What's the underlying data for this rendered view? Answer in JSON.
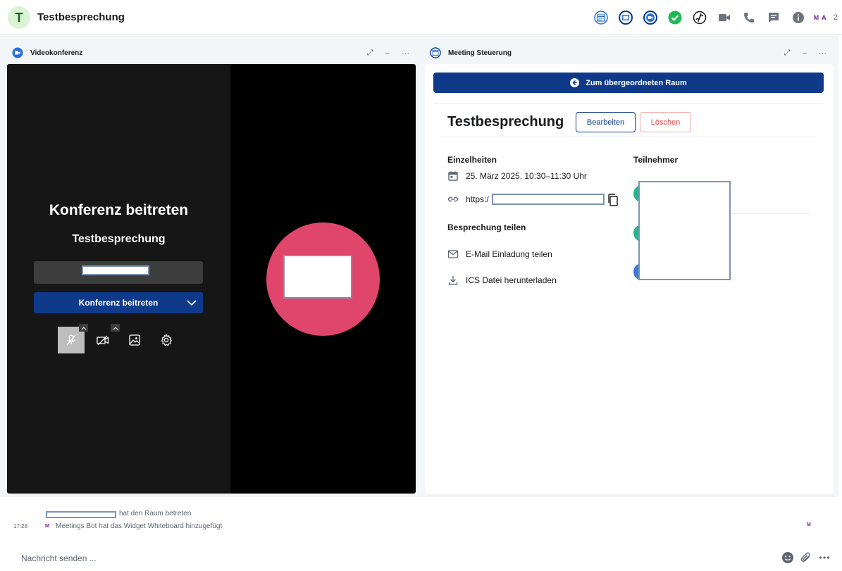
{
  "header": {
    "room_initial": "T",
    "room_title": "Testbesprechung",
    "member_initials": [
      "M",
      "A"
    ],
    "member_count": "2"
  },
  "video_panel": {
    "title": "Videokonferenz",
    "join_title": "Konferenz beitreten",
    "meeting_name": "Testbesprechung",
    "join_button": "Konferenz beitreten"
  },
  "meeting_panel": {
    "title": "Meeting Steuerung",
    "parent_room_button": "Zum übergeordneten Raum",
    "meeting_title": "Testbesprechung",
    "edit_button": "Bearbeiten",
    "delete_button": "Löschen",
    "details_heading": "Einzelheiten",
    "date_time": "25. März 2025, 10:30–11:30 Uhr",
    "link_prefix": "https:/",
    "share_heading": "Besprechung teilen",
    "email_invite": "E-Mail Einladung teilen",
    "ics_download": "ICS Datei herunterladen",
    "participants_heading": "Teilnehmer"
  },
  "timeline": {
    "event1_text": "hat den Raum betreten",
    "event2_time": "17:28",
    "event2_avatar": "M",
    "event2_text": "Meetings Bot hat das Widget Whiteboard hinzugefügt",
    "read_marker": "M"
  },
  "composer": {
    "placeholder": "Nachricht senden ..."
  },
  "colors": {
    "primary": "#0f3a8a",
    "avatar_pink": "#e0466b",
    "danger": "#e14848",
    "green": "#1db954"
  }
}
